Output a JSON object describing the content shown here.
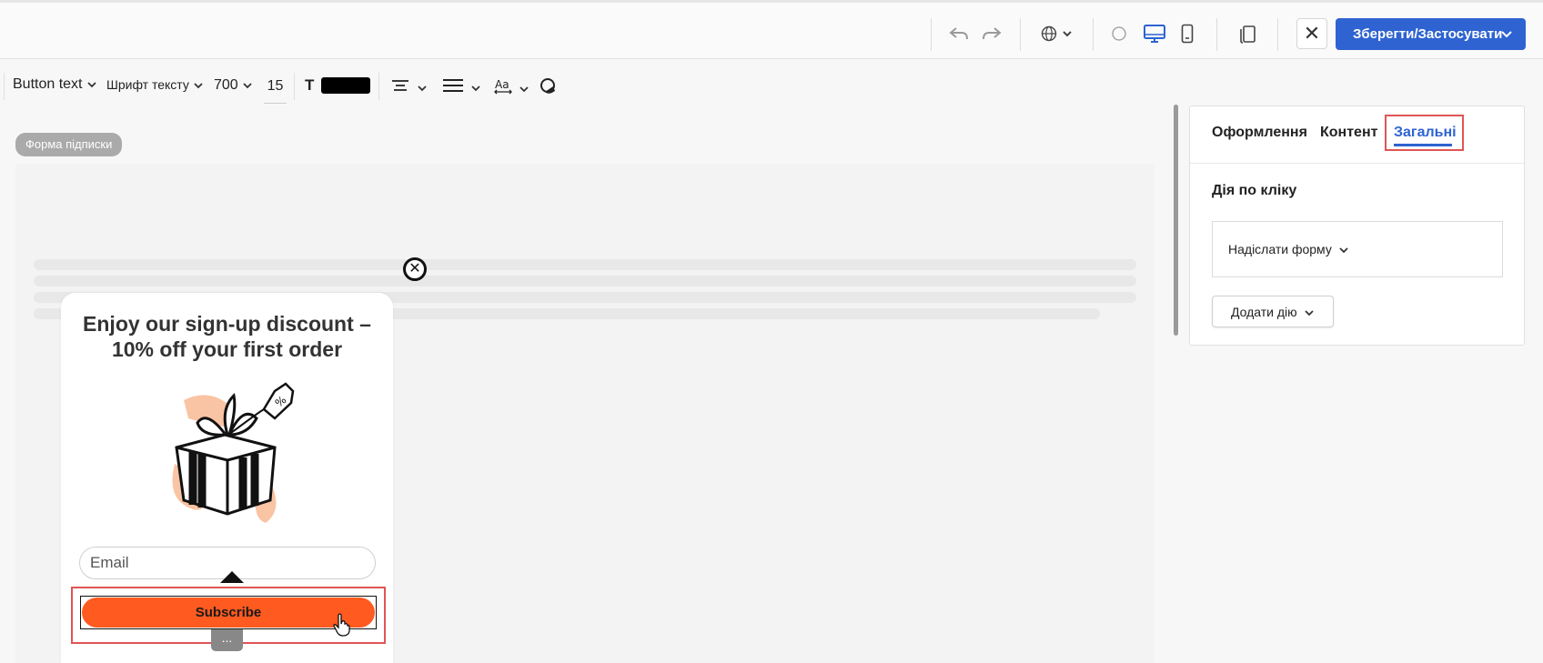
{
  "toolbar": {
    "undo_icon": "undo-icon",
    "redo_icon": "redo-icon",
    "language_icon": "globe-icon",
    "view_icons": [
      "circle-icon",
      "desktop-icon",
      "mobile-icon"
    ],
    "copy_icon": "copy-layout-icon",
    "close_label": "✕",
    "save_label": "Зберегти/Застосувати"
  },
  "format_toolbar": {
    "element_type": "Button text",
    "font_family": "Шрифт тексту",
    "font_weight": "700",
    "font_size": "15",
    "text_color_label": "T",
    "text_color": "#000000"
  },
  "canvas": {
    "badge": "Форма підписки",
    "popup": {
      "close_symbol": "✕",
      "title": "Enjoy our sign-up discount – 10% off your first order",
      "image_icon": "gift-icon",
      "email_placeholder": "Email",
      "subscribe_label": "Subscribe",
      "button_color": "#ff5a1f",
      "more_label": "..."
    }
  },
  "panel": {
    "tabs": [
      {
        "label": "Оформлення"
      },
      {
        "label": "Контент"
      },
      {
        "label": "Загальні",
        "active": true
      }
    ],
    "click_action_label": "Дія по кліку",
    "click_action_value": "Надіслати форму",
    "add_action_label": "Додати дію"
  },
  "colors": {
    "accent": "#2e63d1",
    "highlight": "#e05555"
  }
}
